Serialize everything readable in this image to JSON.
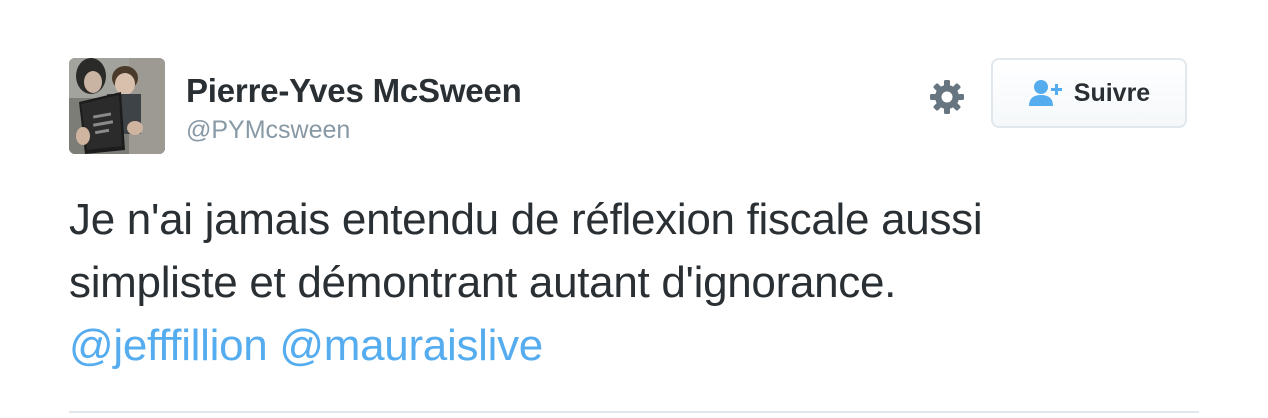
{
  "author": {
    "display_name": "Pierre-Yves McSween",
    "handle": "@PYMcsween"
  },
  "actions": {
    "follow_label": "Suivre",
    "settings_icon": "gear-icon",
    "follow_icon": "add-user-icon"
  },
  "tweet": {
    "line1": "Je n'ai jamais entendu de réflexion fiscale aussi",
    "line2": "simpliste et démontrant autant d'ignorance.",
    "mentions": [
      "@jefffillion",
      "@mauraislive"
    ]
  },
  "colors": {
    "text": "#292f33",
    "muted": "#8899a6",
    "link": "#55acee",
    "border": "#e1e8ed"
  }
}
